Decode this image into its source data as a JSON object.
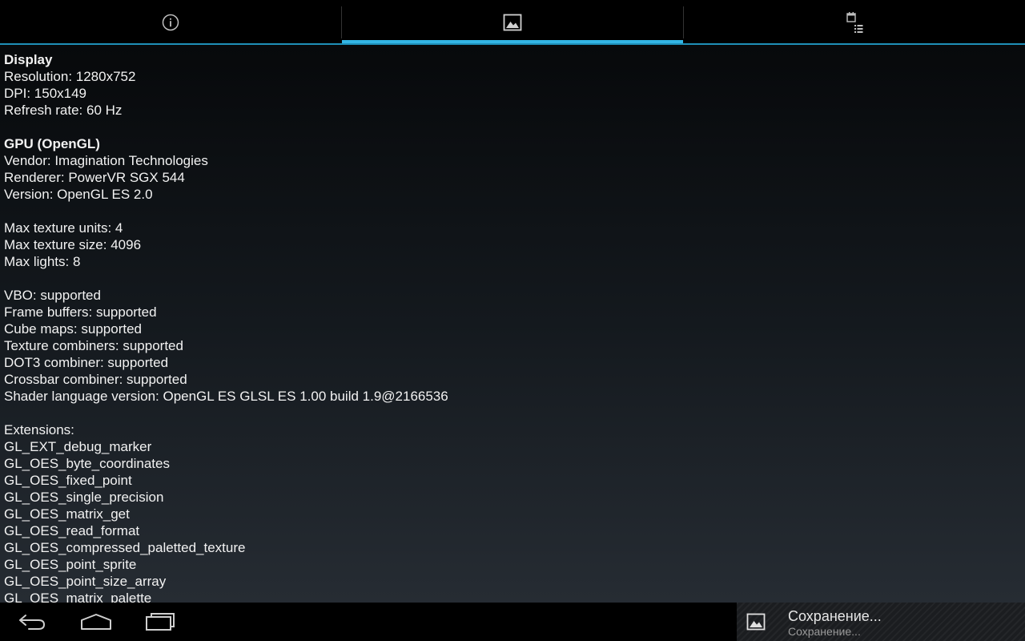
{
  "tabs": [
    {
      "icon": "info-icon",
      "selected": false
    },
    {
      "icon": "image-icon",
      "selected": true
    },
    {
      "icon": "calendar-list-icon",
      "selected": false
    }
  ],
  "colors": {
    "accent": "#33b5e5",
    "tab_baseline": "#1f8fb8",
    "text": "#f2f2f2",
    "background_top": "#07090b",
    "background_bottom": "#262c33"
  },
  "content": {
    "lines": [
      {
        "text": "Display",
        "bold": true
      },
      {
        "text": "Resolution: 1280x752",
        "bold": false
      },
      {
        "text": "DPI: 150x149",
        "bold": false
      },
      {
        "text": "Refresh rate: 60 Hz",
        "bold": false
      },
      {
        "text": "",
        "bold": false
      },
      {
        "text": "GPU (OpenGL)",
        "bold": true
      },
      {
        "text": "Vendor: Imagination Technologies",
        "bold": false
      },
      {
        "text": "Renderer: PowerVR SGX 544",
        "bold": false
      },
      {
        "text": "Version: OpenGL ES 2.0",
        "bold": false
      },
      {
        "text": "",
        "bold": false
      },
      {
        "text": "Max texture units: 4",
        "bold": false
      },
      {
        "text": "Max texture size: 4096",
        "bold": false
      },
      {
        "text": "Max lights: 8",
        "bold": false
      },
      {
        "text": "",
        "bold": false
      },
      {
        "text": "VBO: supported",
        "bold": false
      },
      {
        "text": "Frame buffers: supported",
        "bold": false
      },
      {
        "text": "Cube maps: supported",
        "bold": false
      },
      {
        "text": "Texture combiners: supported",
        "bold": false
      },
      {
        "text": "DOT3 combiner: supported",
        "bold": false
      },
      {
        "text": "Crossbar combiner: supported",
        "bold": false
      },
      {
        "text": "Shader language version: OpenGL ES GLSL ES 1.00 build 1.9@2166536",
        "bold": false
      },
      {
        "text": "",
        "bold": false
      },
      {
        "text": "Extensions:",
        "bold": false
      },
      {
        "text": "GL_EXT_debug_marker",
        "bold": false
      },
      {
        "text": "GL_OES_byte_coordinates",
        "bold": false
      },
      {
        "text": "GL_OES_fixed_point",
        "bold": false
      },
      {
        "text": "GL_OES_single_precision",
        "bold": false
      },
      {
        "text": "GL_OES_matrix_get",
        "bold": false
      },
      {
        "text": "GL_OES_read_format",
        "bold": false
      },
      {
        "text": "GL_OES_compressed_paletted_texture",
        "bold": false
      },
      {
        "text": "GL_OES_point_sprite",
        "bold": false
      },
      {
        "text": "GL_OES_point_size_array",
        "bold": false
      },
      {
        "text": "GL_OES_matrix_palette",
        "bold": false
      }
    ]
  },
  "navbar": {
    "back_icon": "back-icon",
    "home_icon": "home-icon",
    "recents_icon": "recent-apps-icon"
  },
  "notification": {
    "icon": "image-icon",
    "title": "Сохранение...",
    "subtitle": "Сохранение..."
  }
}
